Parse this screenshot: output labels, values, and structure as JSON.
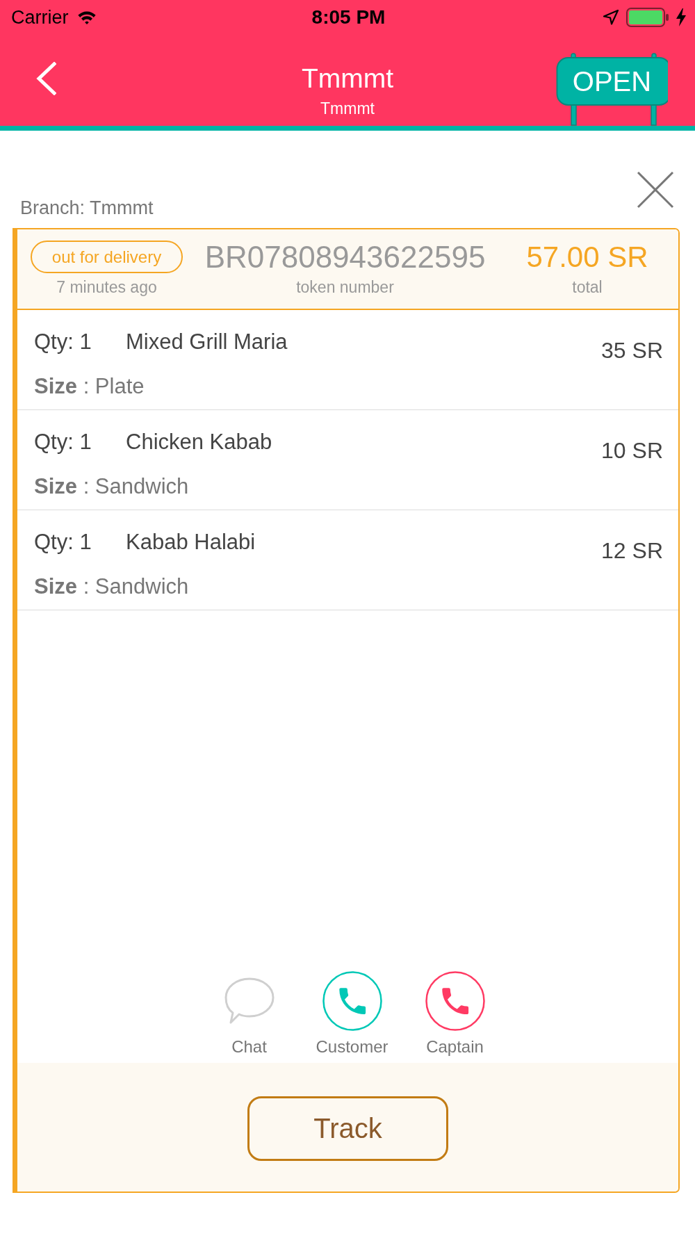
{
  "status_bar": {
    "carrier": "Carrier",
    "time": "8:05 PM"
  },
  "nav": {
    "title": "Tmmmt",
    "subtitle": "Tmmmt",
    "sign": "OPEN"
  },
  "branch": "Branch: Tmmmt",
  "order": {
    "status": "out for delivery",
    "time": "7 minutes ago",
    "token": "BR07808943622595",
    "token_label": "token number",
    "total": "57.00 SR",
    "total_label": "total",
    "items": [
      {
        "qty": "Qty: 1",
        "name": "Mixed Grill Maria",
        "size": "**Size** : Plate",
        "price": "35 SR"
      },
      {
        "qty": "Qty: 1",
        "name": "Chicken Kabab",
        "size": "**Size** : Sandwich",
        "price": "10 SR"
      },
      {
        "qty": "Qty: 1",
        "name": "Kabab Halabi",
        "size": "**Size** : Sandwich",
        "price": "12 SR"
      }
    ],
    "actions": [
      {
        "kind": "chat",
        "label": "Chat"
      },
      {
        "kind": "call",
        "label": "Customer",
        "color": "#00c8b6"
      },
      {
        "kind": "call",
        "label": "Captain",
        "color": "#ff3a63"
      }
    ],
    "track": "Track"
  }
}
